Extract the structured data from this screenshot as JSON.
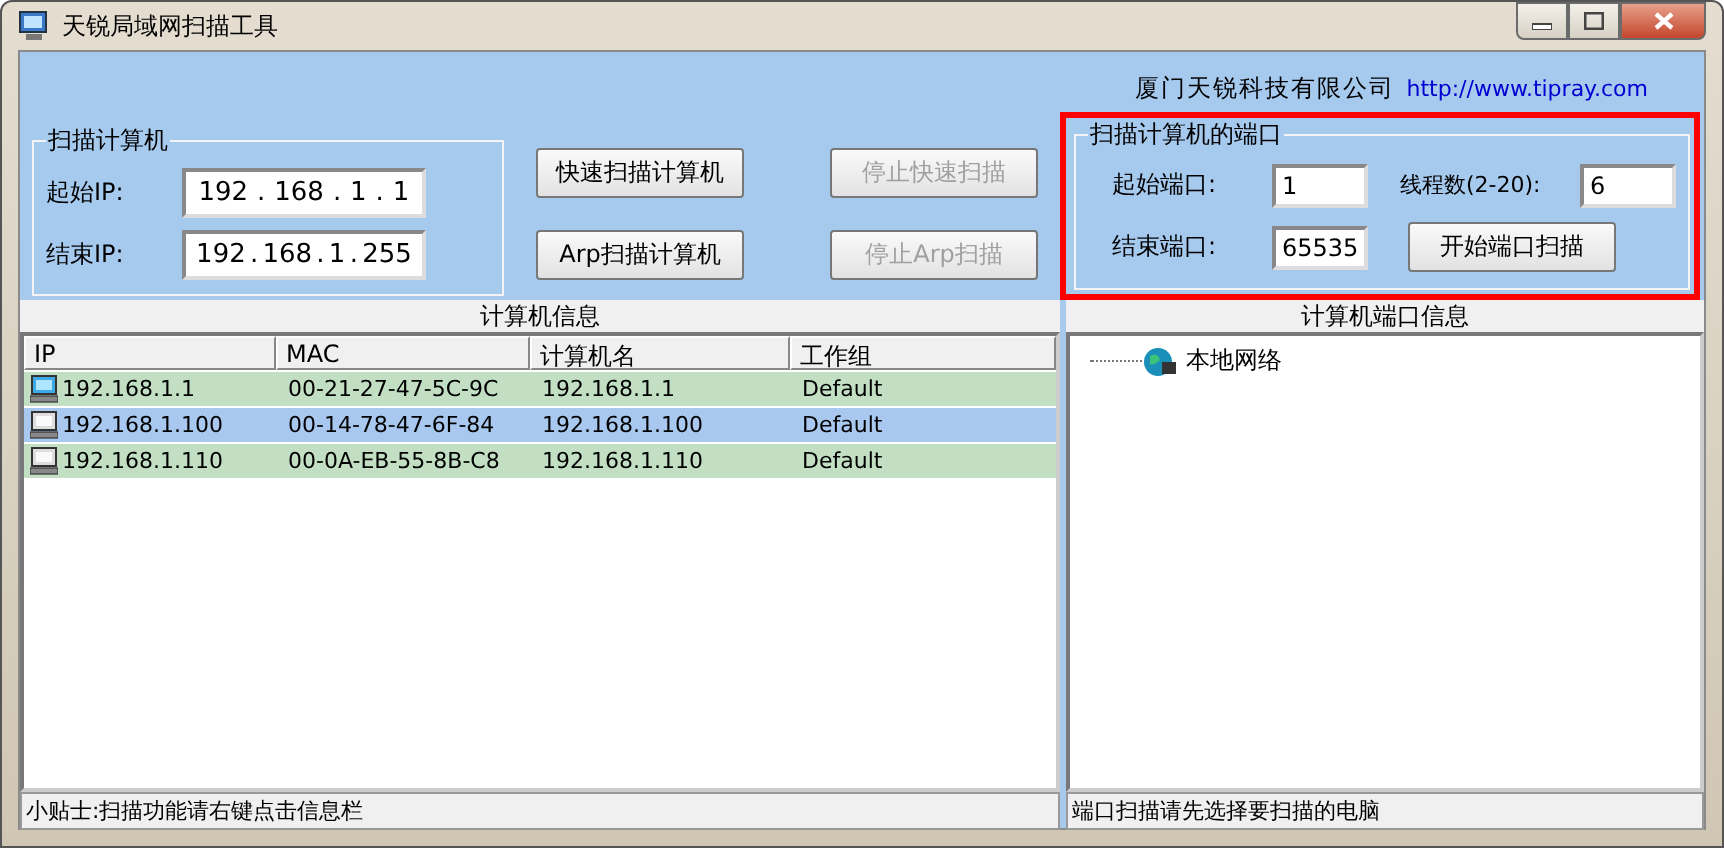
{
  "window": {
    "title": "天锐局域网扫描工具"
  },
  "company": {
    "name": "厦门天锐科技有限公司",
    "url": "http://www.tipray.com"
  },
  "scan_hosts": {
    "title": "扫描计算机",
    "start_label": "起始IP:",
    "start_ip": [
      "192",
      "168",
      "1",
      "1"
    ],
    "end_label": "结束IP:",
    "end_ip": [
      "192",
      "168",
      "1",
      "255"
    ],
    "separator": "."
  },
  "buttons": [
    {
      "label": "快速扫描计算机",
      "disabled": false
    },
    {
      "label": "停止快速扫描",
      "disabled": true
    },
    {
      "label": "Arp扫描计算机",
      "disabled": false
    },
    {
      "label": "停止Arp扫描",
      "disabled": true
    }
  ],
  "scan_ports": {
    "title": "扫描计算机的端口",
    "start_label": "起始端口:",
    "start_value": "1",
    "threads_label": "线程数(2-20):",
    "threads_value": "6",
    "end_label": "结束端口:",
    "end_value": "65535",
    "button": "开始端口扫描"
  },
  "hosts_panel": {
    "title": "计算机信息",
    "columns": [
      "IP",
      "MAC",
      "计算机名",
      "工作组"
    ],
    "rows": [
      {
        "kind": "local",
        "selected": false,
        "cells": [
          "192.168.1.1",
          "00-21-27-47-5C-9C",
          "192.168.1.1",
          "Default"
        ]
      },
      {
        "kind": "remote",
        "selected": true,
        "cells": [
          "192.168.1.100",
          "00-14-78-47-6F-84",
          "192.168.1.100",
          "Default"
        ]
      },
      {
        "kind": "remote",
        "selected": false,
        "cells": [
          "192.168.1.110",
          "00-0A-EB-55-8B-C8",
          "192.168.1.110",
          "Default"
        ]
      }
    ]
  },
  "ports_panel": {
    "title": "计算机端口信息",
    "tree": [
      {
        "label": "本地网络"
      }
    ]
  },
  "status_bar": [
    "小贴士:扫描功能请右键点击信息栏",
    "端口扫描请先选择要扫描的电脑"
  ]
}
